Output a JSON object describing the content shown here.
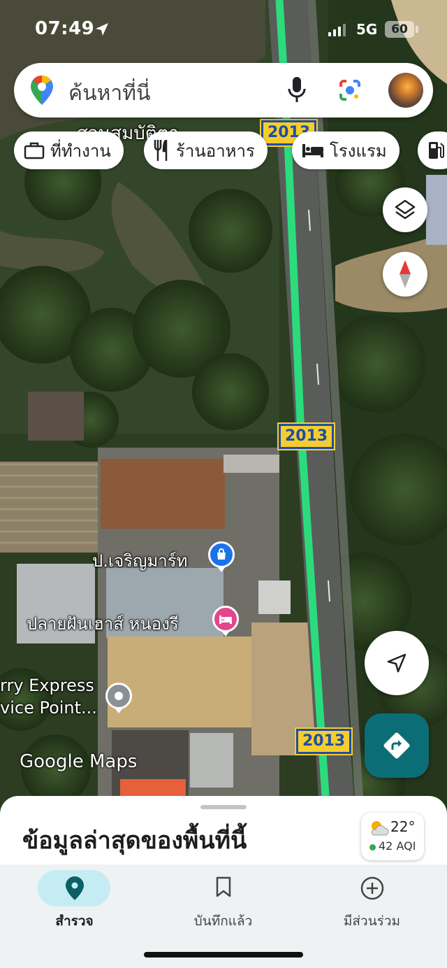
{
  "status_bar": {
    "time": "07:49",
    "network": "5G",
    "battery": "60"
  },
  "search": {
    "placeholder": "ค้นหาที่นี่",
    "icons": [
      "google-maps-pin-icon",
      "microphone-icon",
      "google-lens-icon",
      "profile-avatar"
    ]
  },
  "chips": [
    {
      "label": "ที่ทำงาน",
      "icon": "briefcase-icon"
    },
    {
      "label": "ร้านอาหาร",
      "icon": "restaurant-icon"
    },
    {
      "label": "โรงแรม",
      "icon": "hotel-bed-icon"
    },
    {
      "label": "",
      "icon": "gas-station-icon"
    }
  ],
  "map": {
    "route_number": "2013",
    "pois": [
      {
        "label": "ป.เจริญมาร์ท",
        "icon": "shopping-bag-icon",
        "color": "#1a73e8"
      },
      {
        "label": "ปลายฝันเฮาส์ หนองรี",
        "icon": "hotel-bed-icon",
        "color": "#e2468c"
      },
      {
        "label_line1": "rry Express",
        "label_line2": "vice Point...",
        "icon": "place-dot-icon",
        "color": "#8a9196"
      }
    ],
    "cut_label_top": "สวนสมบัติตา",
    "watermark": "Google Maps",
    "colors": {
      "traffic_green": "#2bdc7d",
      "route_shield_bg": "#f6cd2f",
      "route_shield_fg": "#1d4fa3"
    }
  },
  "controls": {
    "layers": "layers-icon",
    "compass": "compass-icon",
    "my_location": "navigation-arrow-icon",
    "directions": "directions-icon",
    "directions_color": "#0b6e76"
  },
  "sheet": {
    "title": "ข้อมูลล่าสุดของพื้นที่นี้",
    "weather": {
      "temperature": "22°",
      "aqi": "42 AQI",
      "icon": "partly-cloudy-icon"
    }
  },
  "nav": {
    "items": [
      {
        "label": "สำรวจ",
        "icon": "explore-pin-icon",
        "active": true
      },
      {
        "label": "บันทึกแล้ว",
        "icon": "bookmark-icon",
        "active": false
      },
      {
        "label": "มีส่วนร่วม",
        "icon": "add-circle-icon",
        "active": false
      }
    ],
    "active_pill_color": "#c6ecf3"
  }
}
